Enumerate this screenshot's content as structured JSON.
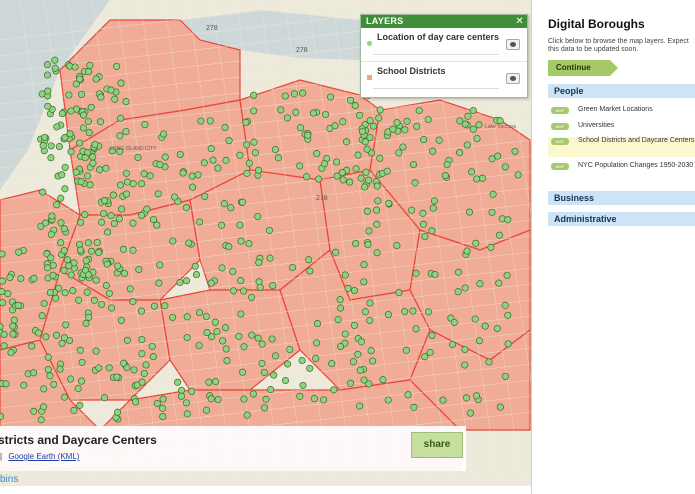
{
  "colors": {
    "district_fill": "#f0a38d",
    "district_border": "#e8463a",
    "dot": "#8fd27f",
    "dot_edge": "#3b6a2d",
    "water": "#cfd8d8",
    "road": "#f4f1e0",
    "accent_green": "#3f8f3a"
  },
  "map": {
    "road_shields": [
      "278",
      "278",
      "278"
    ],
    "neighborhoods": [
      "LONG ISLAND CITY",
      "Lake Success"
    ],
    "attribution_fragment": "bins"
  },
  "layers_panel": {
    "header": "LAYERS",
    "close_icon": "close-icon",
    "layers": [
      {
        "label": "Location of day care centers",
        "swatch": "#8fd27f",
        "visibility_icon": "eye-icon"
      },
      {
        "label": "School Districts",
        "swatch": "#f0a38d",
        "visibility_icon": "eye-icon"
      }
    ]
  },
  "info_bar": {
    "title": "stricts and Daycare Centers",
    "separator": "|",
    "link": "Google Earth (KML)",
    "share_label": "share"
  },
  "sidebar": {
    "title": "Digital Boroughs",
    "description": "Click below to browse the map layers. Expect this data to be updated soon.",
    "continue_label": "Continue",
    "categories": [
      {
        "label": "People",
        "items": [
          {
            "badge": "MAP",
            "label": "Green Market Locations",
            "selected": false
          },
          {
            "badge": "MAP",
            "label": "Universities",
            "selected": false
          },
          {
            "badge": "MAP",
            "label": "School Districts and Daycare Centers",
            "selected": true
          },
          {
            "badge": "MAP",
            "label": "NYC Population Changes 1950-2030",
            "selected": false
          }
        ]
      },
      {
        "label": "Business",
        "items": []
      },
      {
        "label": "Administrative",
        "items": []
      }
    ]
  }
}
